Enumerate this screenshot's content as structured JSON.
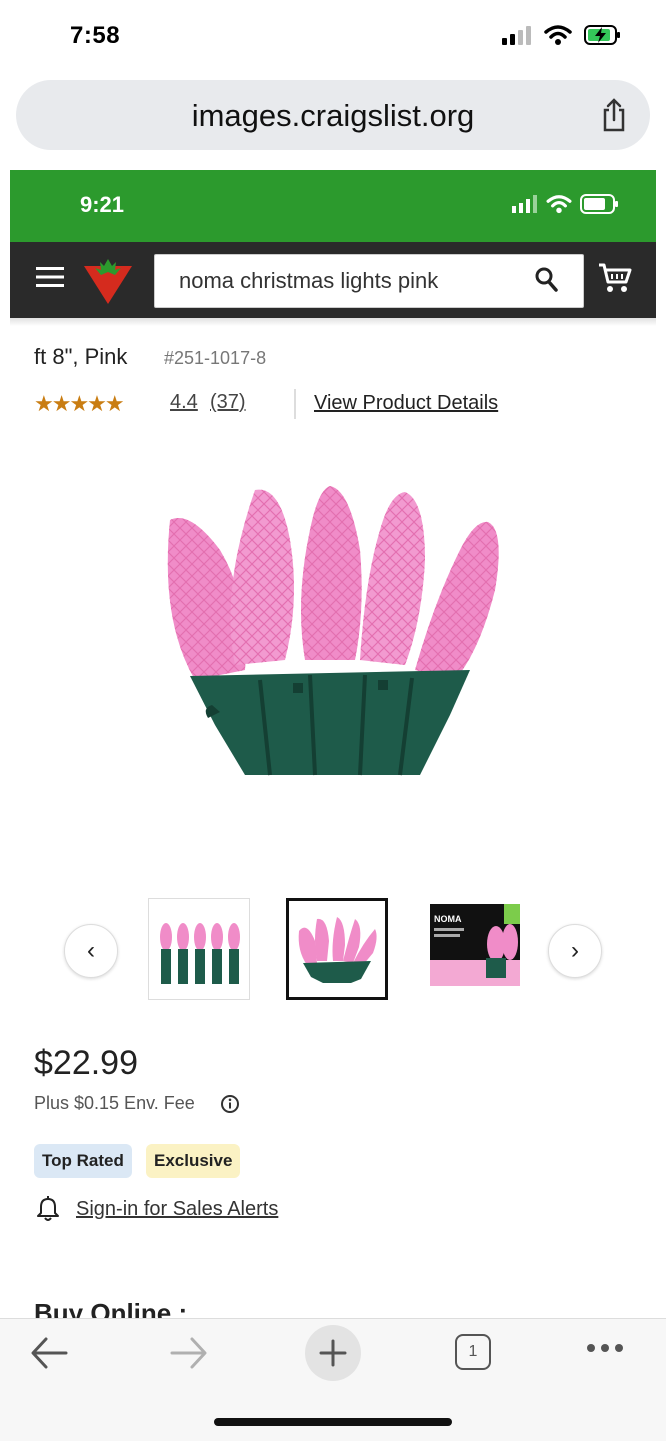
{
  "status_bar": {
    "time": "7:58"
  },
  "browser": {
    "url": "images.craigslist.org"
  },
  "screenshot": {
    "status_bar": {
      "time": "9:21"
    },
    "header": {
      "search_query": "noma christmas lights pink"
    },
    "product": {
      "title_fragment": "ft 8\", Pink",
      "sku": "#251-1017-8",
      "stars": "★★★★★",
      "rating": "4.4",
      "review_count": "(37)",
      "view_details": "View Product Details",
      "prev_label": "‹",
      "next_label": "›",
      "price": "$22.99",
      "env_fee": "Plus $0.15 Env. Fee",
      "badges": [
        "Top Rated",
        "Exclusive"
      ],
      "sales_alert": "Sign-in for Sales Alerts",
      "buy_online": "Buy Online :"
    }
  },
  "toolbar": {
    "tab_count": "1"
  },
  "colors": {
    "green_bar": "#2c9a2d",
    "header_dark": "#2a2a2a",
    "ct_red": "#d52b1e",
    "bulb_pink": "#f08cc8",
    "socket_green": "#1e5b4a",
    "star_gold": "#c97d12"
  },
  "icons": [
    "signal-icon",
    "wifi-icon",
    "battery-charging-icon",
    "share-icon",
    "hamburger-icon",
    "canadian-tire-logo",
    "search-icon",
    "cart-icon",
    "info-icon",
    "bell-icon",
    "back-arrow-icon",
    "forward-arrow-icon",
    "plus-icon",
    "tabs-icon",
    "more-icon"
  ]
}
